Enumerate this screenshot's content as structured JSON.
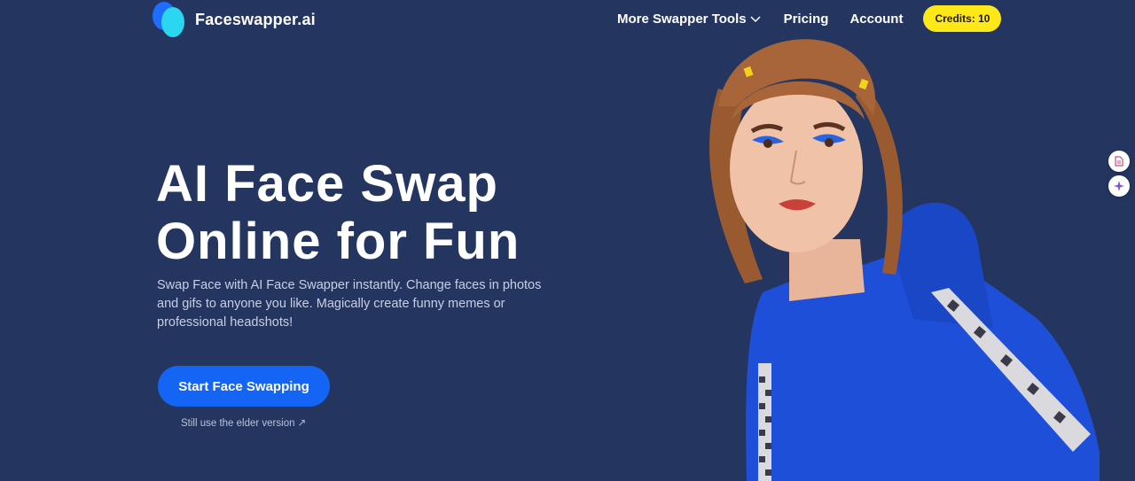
{
  "header": {
    "logo_text": "Faceswapper.ai",
    "nav": {
      "tools_label": "More Swapper Tools",
      "pricing_label": "Pricing",
      "account_label": "Account"
    },
    "credits_label": "Credits: 10"
  },
  "hero": {
    "title_line1": "AI Face Swap",
    "title_line2": "Online for Fun",
    "description": "Swap Face with AI Face Swapper instantly. Change faces in photos and gifs to anyone you like. Magically create funny memes or professional headshots!",
    "cta_label": "Start Face Swapping",
    "elder_link": "Still use the elder version ↗"
  },
  "side_buttons": {
    "icons": [
      "document-icon",
      "sparkle-icon"
    ]
  },
  "colors": {
    "background": "#243660",
    "accent": "#1565f5",
    "credits": "#ffe818",
    "hoodie": "#1d4fd8"
  }
}
